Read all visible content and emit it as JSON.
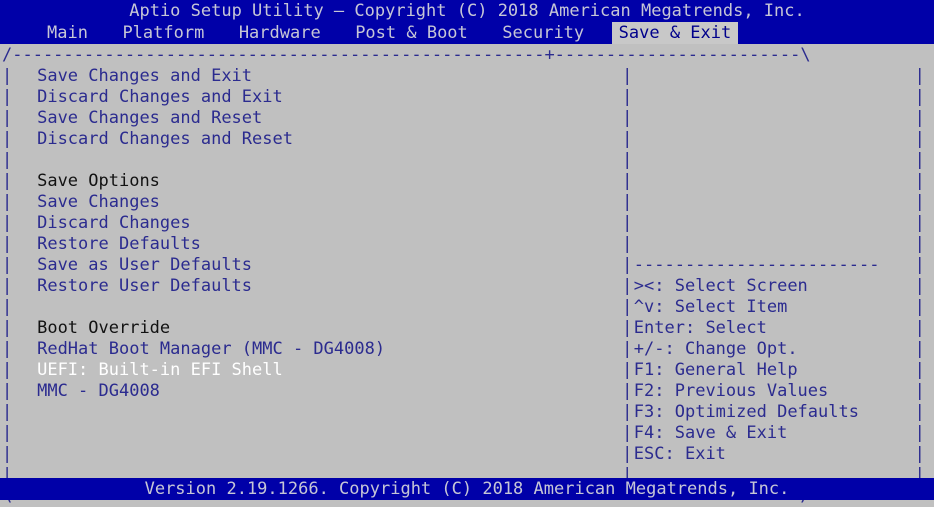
{
  "window": {
    "title": "Aptio Setup Utility – Copyright (C) 2018 American Megatrends, Inc.",
    "footer": "Version 2.19.1266. Copyright (C) 2018 American Megatrends, Inc."
  },
  "menubar": {
    "tabs": [
      {
        "label": "Main",
        "active": false
      },
      {
        "label": "Platform",
        "active": false
      },
      {
        "label": "Hardware",
        "active": false
      },
      {
        "label": "Post & Boot",
        "active": false
      },
      {
        "label": "Security",
        "active": false
      },
      {
        "label": "Save & Exit",
        "active": true
      }
    ]
  },
  "left_pane": {
    "rows": [
      {
        "text": "Save Changes and Exit",
        "style": "item"
      },
      {
        "text": "Discard Changes and Exit",
        "style": "item"
      },
      {
        "text": "Save Changes and Reset",
        "style": "item"
      },
      {
        "text": "Discard Changes and Reset",
        "style": "item"
      },
      {
        "text": "",
        "style": "blank"
      },
      {
        "text": "Save Options",
        "style": "header"
      },
      {
        "text": "Save Changes",
        "style": "item"
      },
      {
        "text": "Discard Changes",
        "style": "item"
      },
      {
        "text": "Restore Defaults",
        "style": "item"
      },
      {
        "text": "Save as User Defaults",
        "style": "item"
      },
      {
        "text": "Restore User Defaults",
        "style": "item"
      },
      {
        "text": "",
        "style": "blank"
      },
      {
        "text": "Boot Override",
        "style": "header"
      },
      {
        "text": "RedHat Boot Manager (MMC - DG4008)",
        "style": "item"
      },
      {
        "text": "UEFI: Built-in EFI Shell",
        "style": "selected"
      },
      {
        "text": "MMC - DG4008",
        "style": "item"
      }
    ]
  },
  "right_pane": {
    "help_keys": [
      "><: Select Screen",
      "^v: Select Item",
      "Enter: Select",
      "+/-: Change Opt.",
      "F1: General Help",
      "F2: Previous Values",
      "F3: Optimized Defaults",
      "F4: Save & Exit",
      "ESC: Exit"
    ]
  },
  "frame": {
    "corner_tl": "/",
    "corner_tr": "\\",
    "corner_bl": "\\",
    "corner_br": "/",
    "tee": "+",
    "horizontal": "-",
    "vertical": "|"
  },
  "colors": {
    "bar_background": "#0000a8",
    "bar_text": "#c6c6d6",
    "body_background": "#c0c0c0",
    "item_text": "#2b2b8f",
    "header_text": "#121212",
    "selected_text": "#ffffff",
    "active_tab_background": "#c8c8c8",
    "active_tab_text": "#00008b"
  },
  "metrics": {
    "char_width": 11.7,
    "line_height": 21,
    "left_pane_cols": 53,
    "right_pane_cols": 26
  }
}
